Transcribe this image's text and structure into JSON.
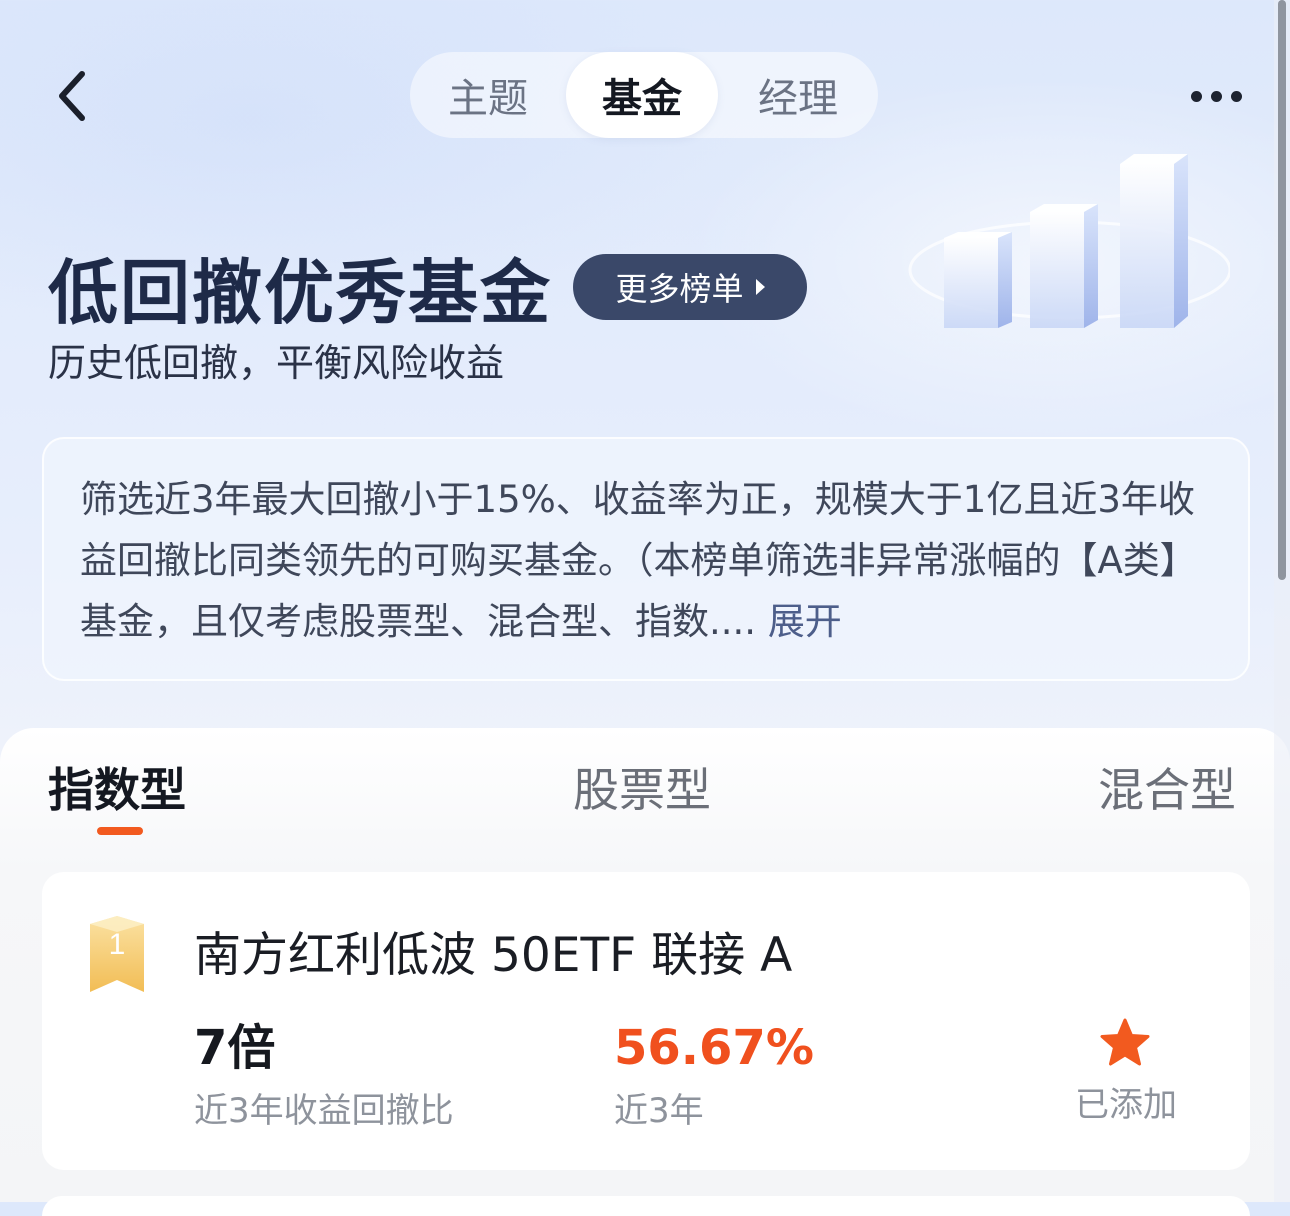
{
  "header": {
    "back_icon": "chevron-left-icon",
    "segments": [
      {
        "label": "主题",
        "active": false
      },
      {
        "label": "基金",
        "active": true
      },
      {
        "label": "经理",
        "active": false
      }
    ],
    "more_icon": "more-dots-icon"
  },
  "hero": {
    "title": "低回撤优秀基金",
    "more_lists_label": "更多榜单",
    "subtitle": "历史低回撤，平衡风险收益",
    "illustration_icon": "bar-chart-illustration-icon"
  },
  "description": {
    "text": "筛选近3年最大回撤小于15%、收益率为正，规模大于1亿且近3年收益回撤比同类领先的可购买基金。（本榜单筛选非异常涨幅的【A类】基金，且仅考虑股票型、混合型、指数....",
    "expand_label": "展开"
  },
  "type_tabs": [
    {
      "label": "指数型",
      "active": true
    },
    {
      "label": "股票型",
      "active": false
    },
    {
      "label": "混合型",
      "active": false
    }
  ],
  "funds": [
    {
      "rank": "1",
      "name": "南方红利低波 50ETF 联接 A",
      "ratio_value": "7倍",
      "ratio_label": "近3年收益回撤比",
      "return_value": "56.67%",
      "return_label": "近3年",
      "added_label": "已添加"
    }
  ],
  "colors": {
    "accent": "#f25a1f",
    "button_dark": "#3a4869",
    "title": "#1e2a48",
    "return_positive": "#f0501e",
    "badge_gold": "#f4c76a"
  }
}
